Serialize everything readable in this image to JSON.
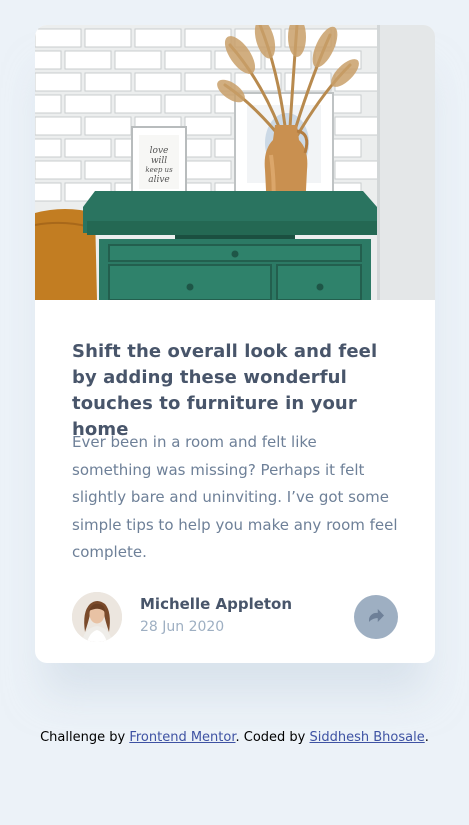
{
  "article": {
    "title": "Shift the overall look and feel by adding these wonderful touches to furniture in your home",
    "description": "Ever been in a room and felt like something was missing? Perhaps it felt slightly bare and uninviting. I’ve got some simple tips to help you make any room feel complete.",
    "image_icon": "drawers-photo"
  },
  "author": {
    "name": "Michelle Appleton",
    "date": "28 Jun 2020",
    "avatar_icon": "avatar-photo"
  },
  "share": {
    "icon": "share-arrow-icon"
  },
  "attribution": {
    "prefix": "Challenge by",
    "link1": "Frontend Mentor",
    "middle": ". Coded by",
    "link2": "Siddhesh Bhosale",
    "suffix": "."
  },
  "colors": {
    "background": "#ecf2f8",
    "title": "#48556a",
    "text": "#6e8098",
    "muted": "#9eafc2",
    "link": "#3e52a3"
  }
}
